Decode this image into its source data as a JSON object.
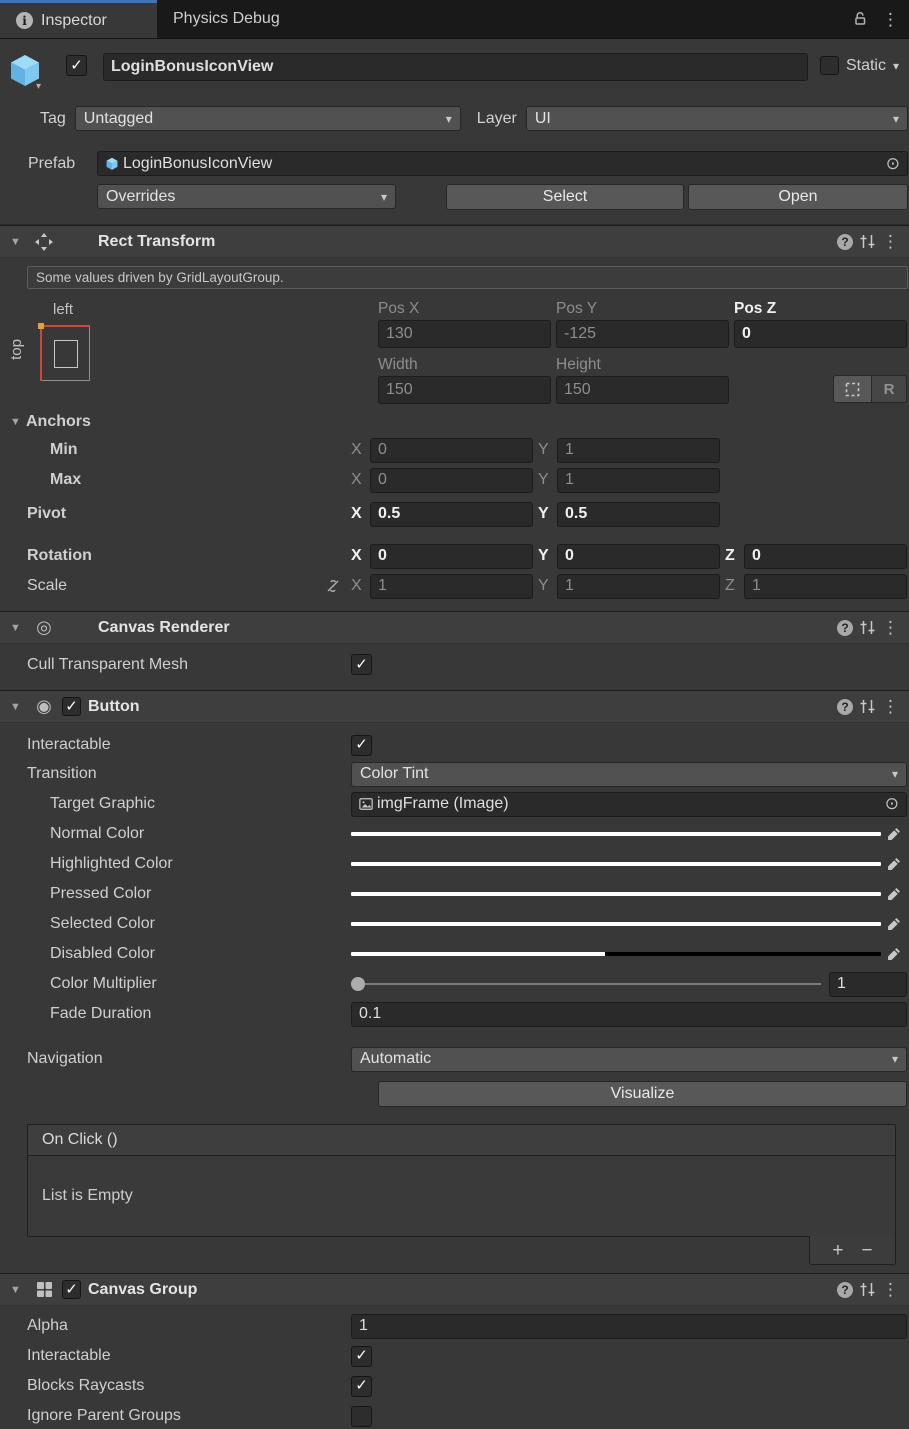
{
  "colors": {
    "accent_blue": "#3c76b8",
    "panel_bg": "#383838",
    "tabbar_bg": "#191919",
    "field_bg": "#2a2a2a",
    "swatch_normal": "#ffffff",
    "swatch_highlighted": "#f5f5f5",
    "swatch_pressed": "#c8c8c8",
    "swatch_selected": "#f5f5f5",
    "swatch_disabled": "#c8c8c8",
    "anchor_edge_red": "#c34b42",
    "anchor_dot_orange": "#e0a33c"
  },
  "icons": {
    "foldout": "▼",
    "dropdown_arrow": "▾",
    "kebab": "⋮",
    "check": "✓",
    "picker": "⊙",
    "help": "?",
    "info": "i",
    "plus": "+",
    "minus": "−",
    "canvas_renderer": "◎",
    "button_circle": "◉"
  },
  "tabbar": {
    "inspector_tab": "Inspector",
    "physics_tab": "Physics Debug"
  },
  "go": {
    "name": "LoginBonusIconView",
    "static_label": "Static",
    "tag_label": "Tag",
    "tag_value": "Untagged",
    "layer_label": "Layer",
    "layer_value": "UI"
  },
  "prefab": {
    "label": "Prefab",
    "name": "LoginBonusIconView",
    "overrides": "Overrides",
    "select": "Select",
    "open": "Open"
  },
  "rt": {
    "title": "Rect Transform",
    "notice": "Some values driven by GridLayoutGroup.",
    "anchor_h": "left",
    "anchor_v": "top",
    "posx_label": "Pos X",
    "posx": "130",
    "posy_label": "Pos Y",
    "posy": "-125",
    "posz_label": "Pos Z",
    "posz": "0",
    "width_label": "Width",
    "width": "150",
    "height_label": "Height",
    "height": "150",
    "r_label": "R",
    "anchors_label": "Anchors",
    "min_label": "Min",
    "min_x": "0",
    "min_y": "1",
    "max_label": "Max",
    "max_x": "0",
    "max_y": "1",
    "pivot_label": "Pivot",
    "pivot_x": "0.5",
    "pivot_y": "0.5",
    "rotation_label": "Rotation",
    "rot_x": "0",
    "rot_y": "0",
    "rot_z": "0",
    "scale_label": "Scale",
    "scale_x": "1",
    "scale_y": "1",
    "scale_z": "1",
    "x": "X",
    "y": "Y",
    "z": "Z"
  },
  "canvas_renderer": {
    "title": "Canvas Renderer",
    "cull_label": "Cull Transparent Mesh"
  },
  "button": {
    "title": "Button",
    "interactable_label": "Interactable",
    "transition_label": "Transition",
    "transition_value": "Color Tint",
    "target_graphic_label": "Target Graphic",
    "target_graphic_value": "imgFrame (Image)",
    "normal_label": "Normal Color",
    "highlighted_label": "Highlighted Color",
    "pressed_label": "Pressed Color",
    "selected_label": "Selected Color",
    "disabled_label": "Disabled Color",
    "multiplier_label": "Color Multiplier",
    "multiplier_value": "1",
    "fade_label": "Fade Duration",
    "fade_value": "0.1",
    "navigation_label": "Navigation",
    "navigation_value": "Automatic",
    "visualize_label": "Visualize",
    "onclick_title": "On Click ()",
    "empty_label": "List is Empty"
  },
  "canvas_group": {
    "title": "Canvas Group",
    "alpha_label": "Alpha",
    "alpha_value": "1",
    "interactable_label": "Interactable",
    "blocks_label": "Blocks Raycasts",
    "ignore_label": "Ignore Parent Groups"
  }
}
